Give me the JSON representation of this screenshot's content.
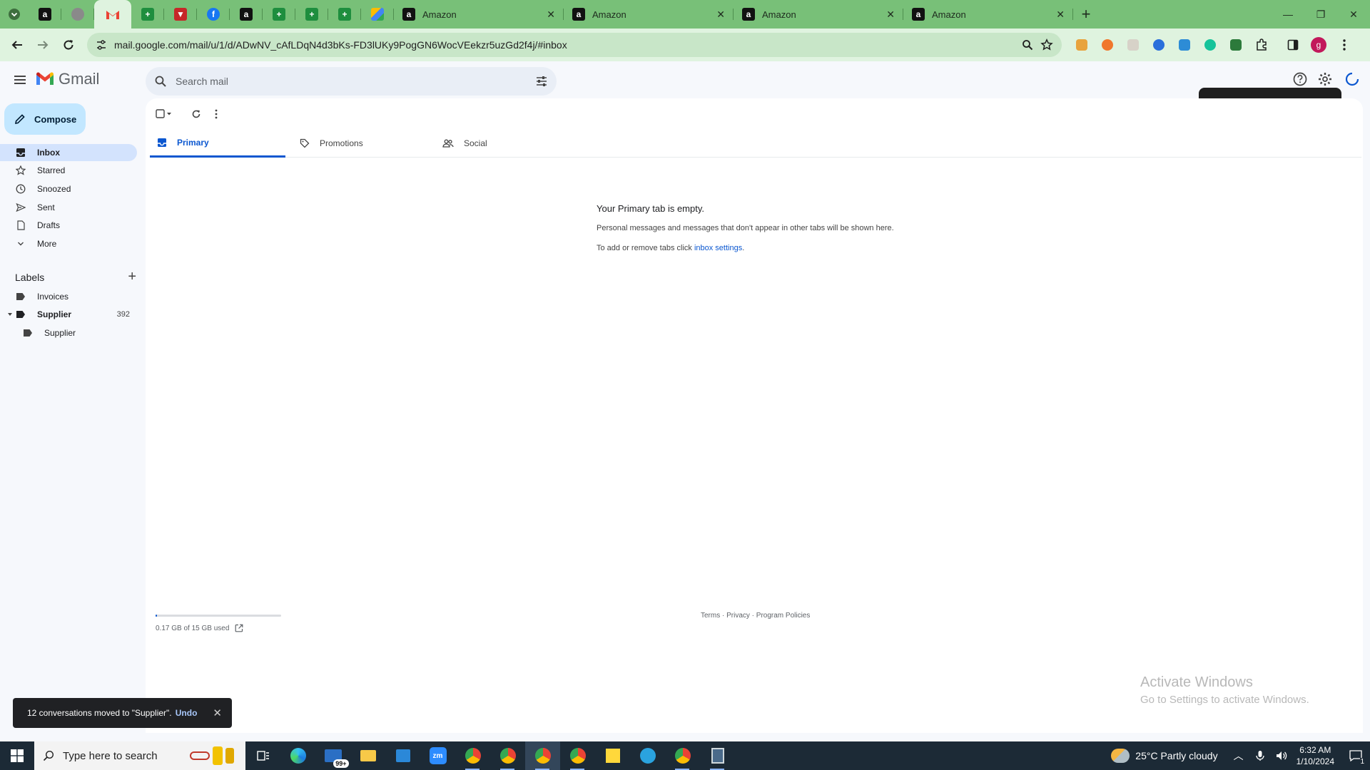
{
  "browser": {
    "tabs": [
      {
        "title": "Amazon"
      },
      {
        "title": "Amazon"
      },
      {
        "title": "Amazon"
      },
      {
        "title": "Amazon"
      }
    ],
    "url": "mail.google.com/mail/u/1/d/ADwNV_cAfLDqN4d3bKs-FD3lUKy9PogGN6WocVEekzr5uzGd2f4j/#inbox",
    "profile_initial": "g"
  },
  "gmail": {
    "logo_text": "Gmail",
    "search_placeholder": "Search mail",
    "compose_label": "Compose",
    "nav": [
      {
        "label": "Inbox",
        "icon": "inbox-icon",
        "active": true
      },
      {
        "label": "Starred",
        "icon": "star-icon"
      },
      {
        "label": "Snoozed",
        "icon": "clock-icon"
      },
      {
        "label": "Sent",
        "icon": "send-icon"
      },
      {
        "label": "Drafts",
        "icon": "draft-icon"
      },
      {
        "label": "More",
        "icon": "chevron-down-icon"
      }
    ],
    "labels_header": "Labels",
    "labels": [
      {
        "name": "Invoices",
        "count": ""
      },
      {
        "name": "Supplier",
        "count": "392"
      },
      {
        "name": "Supplier",
        "count": ""
      }
    ],
    "tabs": [
      {
        "label": "Primary",
        "icon": "inbox-tab-icon",
        "active": true
      },
      {
        "label": "Promotions",
        "icon": "tag-icon"
      },
      {
        "label": "Social",
        "icon": "people-icon"
      }
    ],
    "empty": {
      "title": "Your Primary tab is empty.",
      "line1": "Personal messages and messages that don't appear in other tabs will be shown here.",
      "line2_prefix": "To add or remove tabs click ",
      "line2_link": "inbox settings",
      "line2_suffix": "."
    },
    "storage": {
      "text": "0.17 GB of 15 GB used",
      "fraction": 0.011
    },
    "footer": "Terms · Privacy · Program Policies",
    "snackbar": {
      "message": "12 conversations moved to \"Supplier\".",
      "undo": "Undo"
    }
  },
  "watermark": {
    "line1": "Activate Windows",
    "line2": "Go to Settings to activate Windows."
  },
  "taskbar": {
    "search_placeholder": "Type here to search",
    "weather": "25°C  Partly cloudy",
    "time": "6:32 AM",
    "date": "1/10/2024",
    "mail_badge": "99+",
    "notification_count": "1"
  },
  "colors": {
    "accent": "#0b57d0",
    "compose": "#c2e7ff",
    "chrome_theme": "#78c078"
  }
}
